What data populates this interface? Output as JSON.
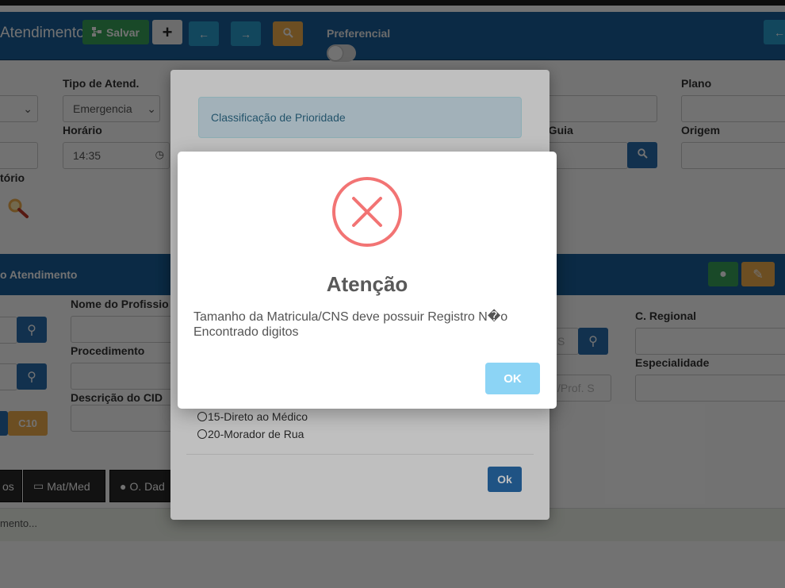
{
  "toolbar": {
    "title": "Atendimento",
    "save_label": "Salvar",
    "add_label": "+",
    "prev_label": "←",
    "next_label": "→",
    "preferencial_label": "Preferencial"
  },
  "form": {
    "tipo_atend_label": "Tipo de Atend.",
    "tipo_atend_value": "Emergencia",
    "horario_label": "Horário",
    "horario_value": "14:35",
    "guia_label": "a Guia",
    "plano_label": "Plano",
    "origem_label": "Origem",
    "torio_label": "tório"
  },
  "section": {
    "title": "o Atendimento",
    "nome_profissional_label": "Nome do Profissio",
    "procedimento_label": "Procedimento",
    "descricao_cid_label": "Descrição do CID",
    "c_regional_label": "C. Regional",
    "especialidade_label": "Especialidade",
    "cod_placeholder": "S",
    "prof_placeholder": "/Prof. S",
    "c10_label": "C10"
  },
  "tabs": [
    {
      "label": "os"
    },
    {
      "label": "Mat/Med"
    },
    {
      "label": "O. Dad"
    }
  ],
  "status_text": "mento...",
  "priority_modal": {
    "alert_text": "Classificação de Prioridade",
    "options": [
      "15-Direto ao Médico",
      "20-Morador de Rua"
    ],
    "ok_label": "Ok"
  },
  "dialog": {
    "title": "Atenção",
    "message": "Tamanho da Matricula/CNS deve possuir Registro N�o Encontrado digitos",
    "ok_label": "OK"
  },
  "colors": {
    "primary": "#1a5f9a",
    "success": "#3aa35a",
    "warning": "#f0ad4e",
    "error_icon": "#f27474",
    "confirm_button": "#8cd4f5"
  }
}
